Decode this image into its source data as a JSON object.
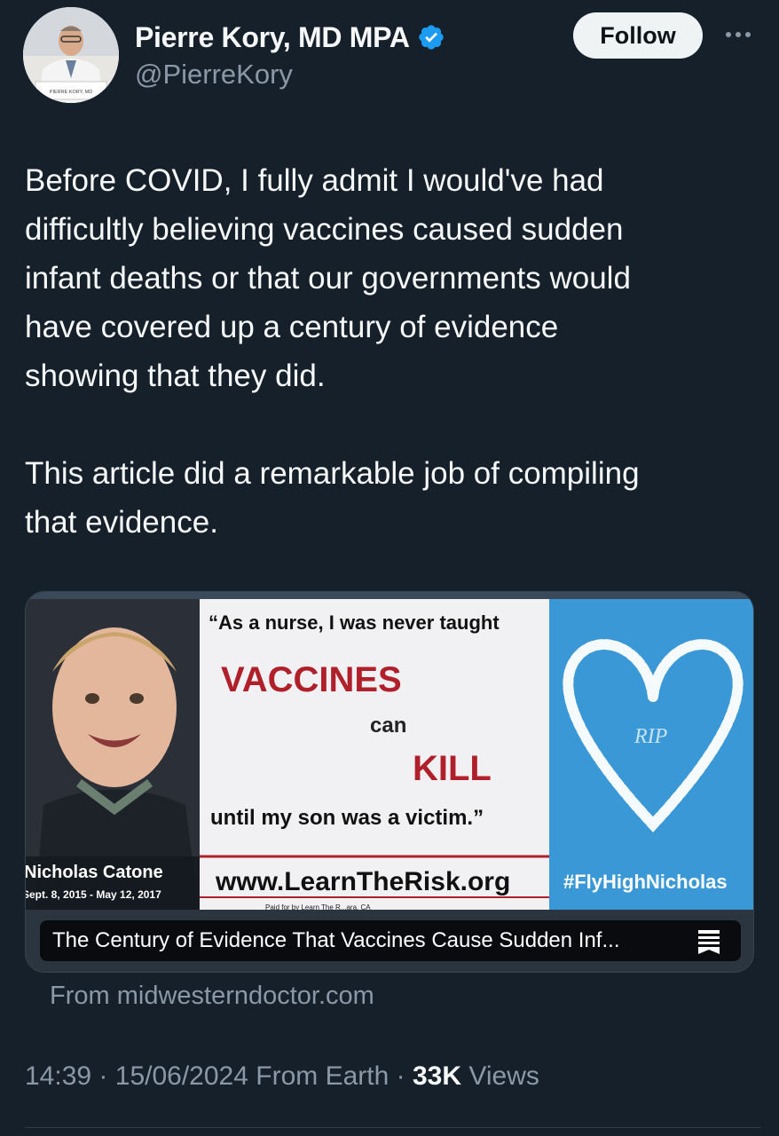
{
  "author": {
    "display_name": "Pierre Kory, MD MPA",
    "handle": "@PierreKory",
    "verified": true,
    "avatar_nameplate": "PIERRE KORY, MD"
  },
  "follow_button": {
    "label": "Follow"
  },
  "more_icon": "more-horizontal-icon",
  "tweet": {
    "paragraphs": [
      "Before COVID, I fully admit I would've had\ndifficultly believing vaccines caused sudden\ninfant deaths or that our governments would\nhave covered up a century of evidence\nshowing that they did.",
      "This article did a remarkable job of compiling\nthat evidence."
    ]
  },
  "card": {
    "image": {
      "quote_line1": "“As a nurse, I was never taught",
      "vaccines": "VACCINES",
      "can": "can",
      "kill": "KILL",
      "quote_line2": "until my son was a victim.”",
      "url": "www.LearnTheRisk.org",
      "paid_for": "Paid for by Learn The R...ara, CA",
      "child_name": "Nicholas Catone",
      "child_dates": "Sept. 8, 2015 - May 12, 2017",
      "rip": "RIP",
      "hashtag": "#FlyHighNicholas"
    },
    "title": "The Century of Evidence That Vaccines Cause Sudden Inf...",
    "source": "From midwesterndoctor.com"
  },
  "meta": {
    "time": "14:39",
    "date": "15/06/2024",
    "location": "From Earth",
    "views_count": "33K",
    "views_label": "Views",
    "separator": "·"
  },
  "colors": {
    "background": "#15202b",
    "primary_text": "#f7f9f9",
    "secondary_text": "#8b98a5",
    "verified_blue": "#1d9bf0",
    "follow_bg": "#eff3f4",
    "billboard_red": "#b0202a",
    "sky_blue": "#3b98d6"
  }
}
